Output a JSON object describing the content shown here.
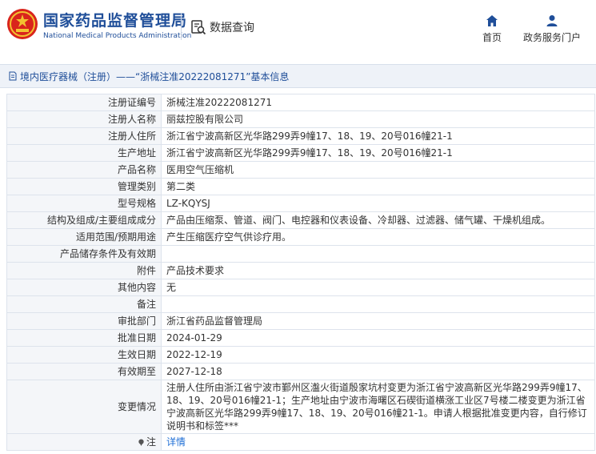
{
  "header": {
    "org_cn": "国家药品监督管理局",
    "org_en": "National Medical Products Administration",
    "query_label": "数据查询",
    "nav": [
      {
        "label": "首页",
        "icon": "home-icon"
      },
      {
        "label": "政务服务门户",
        "icon": "user-icon"
      }
    ]
  },
  "breadcrumb": {
    "text": "境内医疗器械（注册）——“浙械注准20222081271”基本信息"
  },
  "colors": {
    "brand_blue": "#1f4e99",
    "link_blue": "#1f6fd6",
    "label_bg": "#f4f6f9",
    "crumb_bg": "#eef2f8"
  },
  "record": {
    "rows": [
      {
        "label": "注册证编号",
        "value": "浙械注准20222081271"
      },
      {
        "label": "注册人名称",
        "value": "丽兹控股有限公司"
      },
      {
        "label": "注册人住所",
        "value": "浙江省宁波高新区光华路299弄9幢17、18、19、20号016幢21-1"
      },
      {
        "label": "生产地址",
        "value": "浙江省宁波高新区光华路299弄9幢17、18、19、20号016幢21-1"
      },
      {
        "label": "产品名称",
        "value": "医用空气压缩机"
      },
      {
        "label": "管理类别",
        "value": "第二类"
      },
      {
        "label": "型号规格",
        "value": "LZ-KQYSJ"
      },
      {
        "label": "结构及组成/主要组成成分",
        "value": "产品由压缩泵、管道、阀门、电控器和仪表设备、冷却器、过滤器、储气罐、干燥机组成。"
      },
      {
        "label": "适用范围/预期用途",
        "value": "产生压缩医疗空气供诊疗用。"
      },
      {
        "label": "产品储存条件及有效期",
        "value": ""
      },
      {
        "label": "附件",
        "value": "产品技术要求"
      },
      {
        "label": "其他内容",
        "value": "无"
      },
      {
        "label": "备注",
        "value": ""
      },
      {
        "label": "审批部门",
        "value": "浙江省药品监督管理局"
      },
      {
        "label": "批准日期",
        "value": "2024-01-29"
      },
      {
        "label": "生效日期",
        "value": "2022-12-19"
      },
      {
        "label": "有效期至",
        "value": "2027-12-18"
      },
      {
        "label": "变更情况",
        "value": "注册人住所由浙江省宁波市鄞州区瀊火街道殷家坑村变更为浙江省宁波高新区光华路299弄9幢17、18、19、20号016幢21-1；生产地址由宁波市海曙区石碶街道横涨工业区7号楼二楼变更为浙江省宁波高新区光华路299弄9幢17、18、19、20号016幢21-1。申请人根据批准变更内容，自行修订说明书和标签***"
      }
    ],
    "note": {
      "label": "注",
      "link": "详情"
    }
  }
}
